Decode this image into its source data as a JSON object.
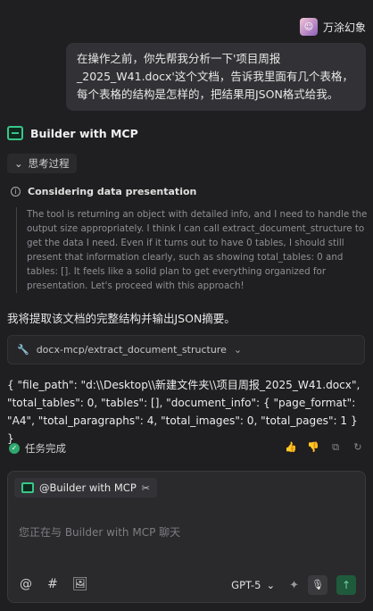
{
  "user": {
    "name": "万涂幻象",
    "message": "在操作之前，你先帮我分析一下'项目周报_2025_W41.docx'这个文档，告诉我里面有几个表格，每个表格的结构是怎样的，把结果用JSON格式给我。"
  },
  "agent": {
    "name": "Builder with MCP",
    "thinking_toggle_label": "思考过程",
    "thinking_title": "Considering data presentation",
    "thinking_text": "The tool is returning an object with detailed info, and I need to handle the output size appropriately. I think I can call extract_document_structure to get the data I need. Even if it turns out to have 0 tables, I should still present that information clearly, such as showing total_tables: 0 and tables: []. It feels like a solid plan to get everything organized for presentation. Let's proceed with this approach!",
    "response_intro": "我将提取该文档的完整结构并输出JSON摘要。",
    "tool_call": "docx-mcp/extract_document_structure",
    "json_output": "{ \"file_path\": \"d:\\\\Desktop\\\\新建文件夹\\\\项目周报_2025_W41.docx\", \"total_tables\": 0, \"tables\": [], \"document_info\": { \"page_format\": \"A4\", \"total_paragraphs\": 4, \"total_images\": 0, \"total_pages\": 1 } }",
    "status": "任务完成"
  },
  "composer": {
    "mention": "@Builder with MCP",
    "placeholder": "您正在与 Builder with MCP 聊天",
    "model": "GPT-5"
  },
  "colors": {
    "background": "#1f1f21",
    "accent_green": "#38c78a",
    "bubble": "#323236"
  }
}
